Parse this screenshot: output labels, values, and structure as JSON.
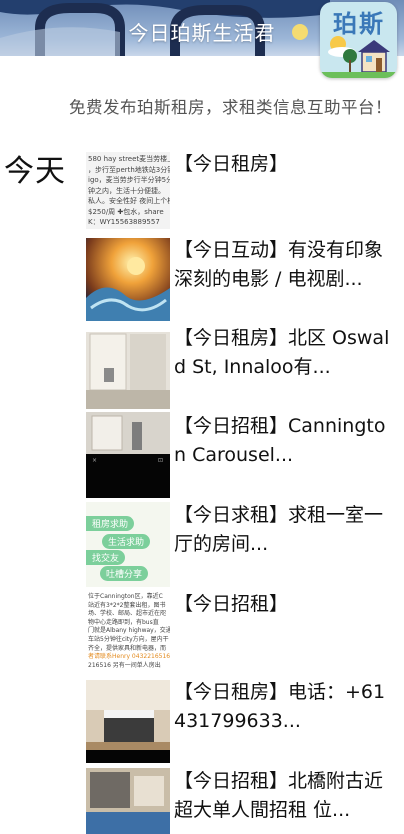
{
  "header": {
    "title": "今日珀斯生活君",
    "logo_text": "珀斯"
  },
  "slogan": "免费发布珀斯租房，求租类信息互助平台！",
  "day_label": "今天",
  "items": [
    {
      "title": "【今日租房】",
      "thumb_lines": [
        "580 hay street麦当劳楼上",
        "，步行至perth地铁站3分钟",
        "igo，麦当劳步行半分钟5分",
        "钟之内，生活十分便捷。",
        "私人。安全性好 夜间上个楼",
        "$250/周 ✚包水，share",
        "K：WY15563889557"
      ]
    },
    {
      "title": "【今日互动】有没有印象深刻的电影 / 电视剧..."
    },
    {
      "title": "【今日租房】北区 Oswald St, Innaloo有..."
    },
    {
      "title": "【今日招租】Cannington Carousel..."
    },
    {
      "title": "【今日求租】求租一室一厅的房间...",
      "thumb_tags": [
        "租房求助",
        "生活求助",
        "找交友",
        "吐槽分享"
      ]
    },
    {
      "title": "【今日招租】",
      "thumb_lines": [
        "位于Cannington区，靠近C",
        "站近有3*2*2整套出租，图书",
        "场、学校、邮局、超市近在咫",
        "物中心走路即到，有bus直",
        "门就是Albany highway，交通",
        "车站5分钟往city方向，屋内干",
        "齐全，提供家具和新电器，而",
        "者请联系Henry 0432216516",
        "216516  另有一间单人房出"
      ]
    },
    {
      "title": "【今日租房】电话：+61431799633..."
    },
    {
      "title": "【今日招租】北橋附古近超大单人間招租 位..."
    }
  ],
  "colors": {
    "banner_top": "#6f8db8",
    "logo_bg": "#c9e7ef",
    "logo_text": "#3a78b8",
    "highlight_phone": "#e38b1f"
  }
}
